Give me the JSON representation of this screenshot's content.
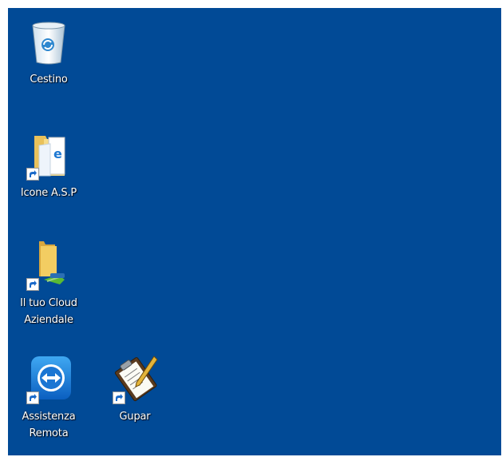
{
  "desktop": {
    "background_color": "#014a96",
    "icons": [
      {
        "name": "recycle-bin",
        "label": "Cestino",
        "icon": "recycle-bin-icon",
        "shortcut": false
      },
      {
        "name": "icone-asp",
        "label": "Icone A.S.P",
        "icon": "folder-document-icon",
        "shortcut": true
      },
      {
        "name": "cloud-aziendale",
        "label": "Il tuo Cloud\nAziendale",
        "icon": "network-folder-icon",
        "shortcut": true
      },
      {
        "name": "assistenza-remota",
        "label": "Assistenza\nRemota",
        "icon": "teamviewer-icon",
        "shortcut": true
      },
      {
        "name": "gupar",
        "label": "Gupar",
        "icon": "clipboard-pencil-icon",
        "shortcut": true
      }
    ]
  }
}
